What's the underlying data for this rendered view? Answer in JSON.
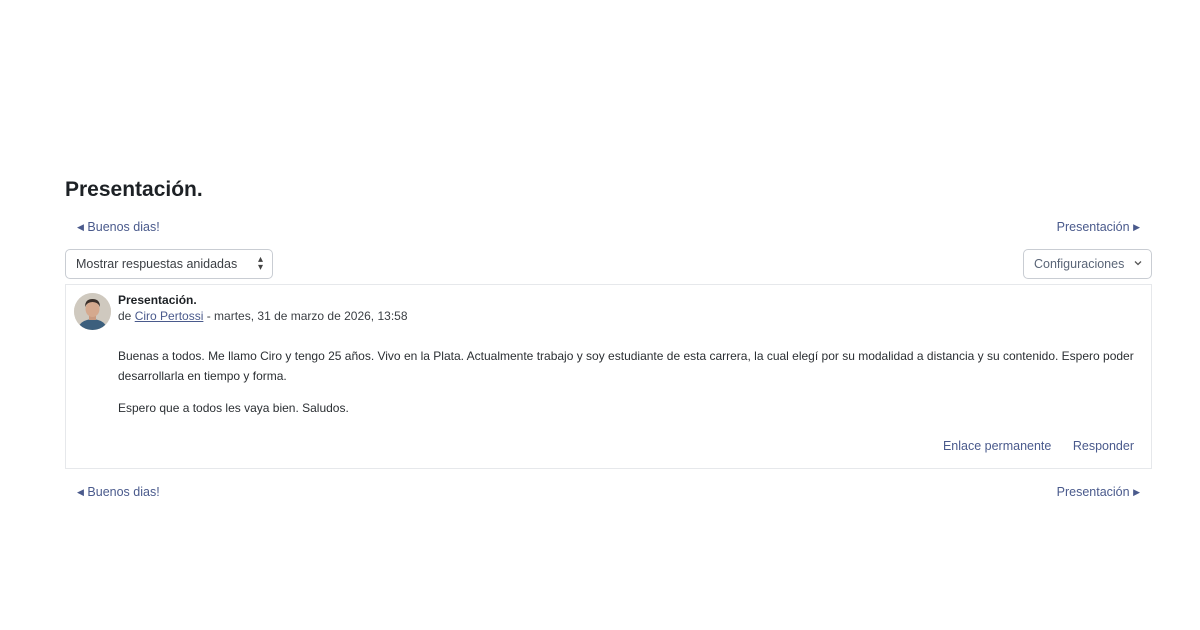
{
  "page": {
    "title": "Presentación."
  },
  "navigation": {
    "prev_label": "Buenos dias!",
    "next_label": "Presentación",
    "prev_arrow": "◀",
    "next_arrow": "▶"
  },
  "controls": {
    "display_mode_selected": "Mostrar respuestas anidadas",
    "settings_label": "Configuraciones"
  },
  "post": {
    "subject": "Presentación.",
    "by_prefix": "de",
    "author": "Ciro Pertossi",
    "date_text": " - martes, 31 de marzo de 2026, 13:58",
    "paragraphs": [
      "Buenas a todos. Me llamo Ciro y tengo 25 años. Vivo en la Plata. Actualmente trabajo y soy estudiante de esta carrera, la cual elegí por su modalidad a distancia y su contenido. Espero poder desarrollarla en tiempo y forma.",
      "Espero que a todos les vaya bien. Saludos."
    ],
    "actions": {
      "permalink_label": "Enlace permanente",
      "reply_label": "Responder"
    }
  },
  "icons": {
    "avatar": "user-avatar-photo",
    "select_caret": "sort-caret-icon",
    "settings_chevron": "chevron-down-icon"
  },
  "colors": {
    "link": "#4a5a8c",
    "border": "#c9cdd3",
    "text": "#1d2125"
  }
}
